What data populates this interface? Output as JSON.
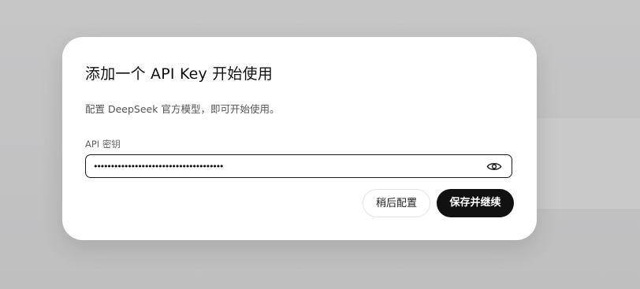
{
  "dialog": {
    "title": "添加一个 API Key 开始使用",
    "description": "配置 DeepSeek 官方模型，即可开始使用。",
    "field_label": "API 密钥",
    "api_key_value": "••••••••••••••••••••••••••••••••••••••",
    "show_password_icon": "eye-icon",
    "later_label": "稍后配置",
    "save_label": "保存并继续"
  },
  "colors": {
    "primary_button": "#111111",
    "dialog_background": "#ffffff",
    "backdrop": "#c2c2c3"
  }
}
